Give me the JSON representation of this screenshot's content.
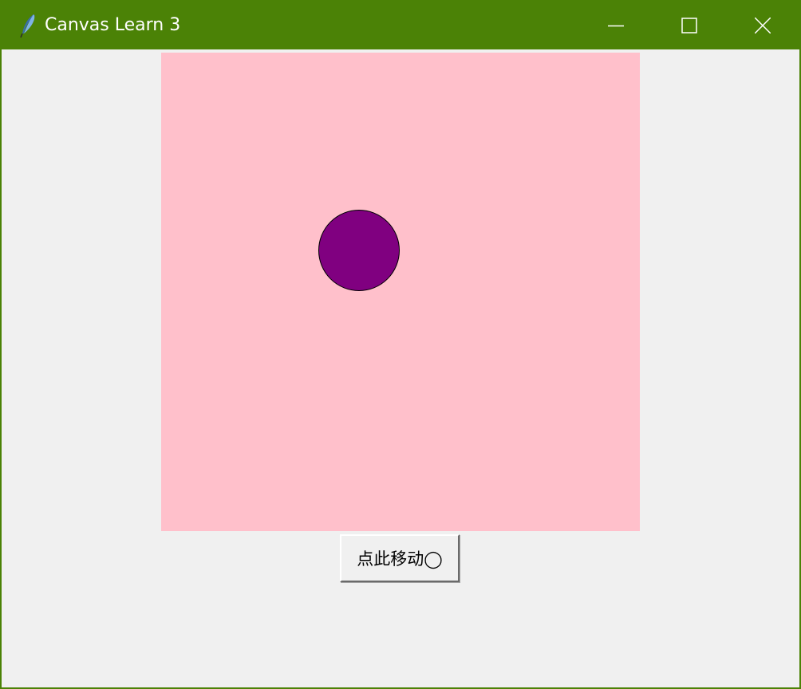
{
  "window": {
    "title": "Canvas Learn 3",
    "accent_color": "#4b8206",
    "controls": {
      "minimize_icon": "minimize-icon",
      "maximize_icon": "maximize-icon",
      "close_icon": "close-icon"
    }
  },
  "canvas": {
    "background_color": "#ffc0cb",
    "circle_fill": "#800080",
    "circle_outline": "#000000"
  },
  "button": {
    "label": "点此移动◯"
  }
}
